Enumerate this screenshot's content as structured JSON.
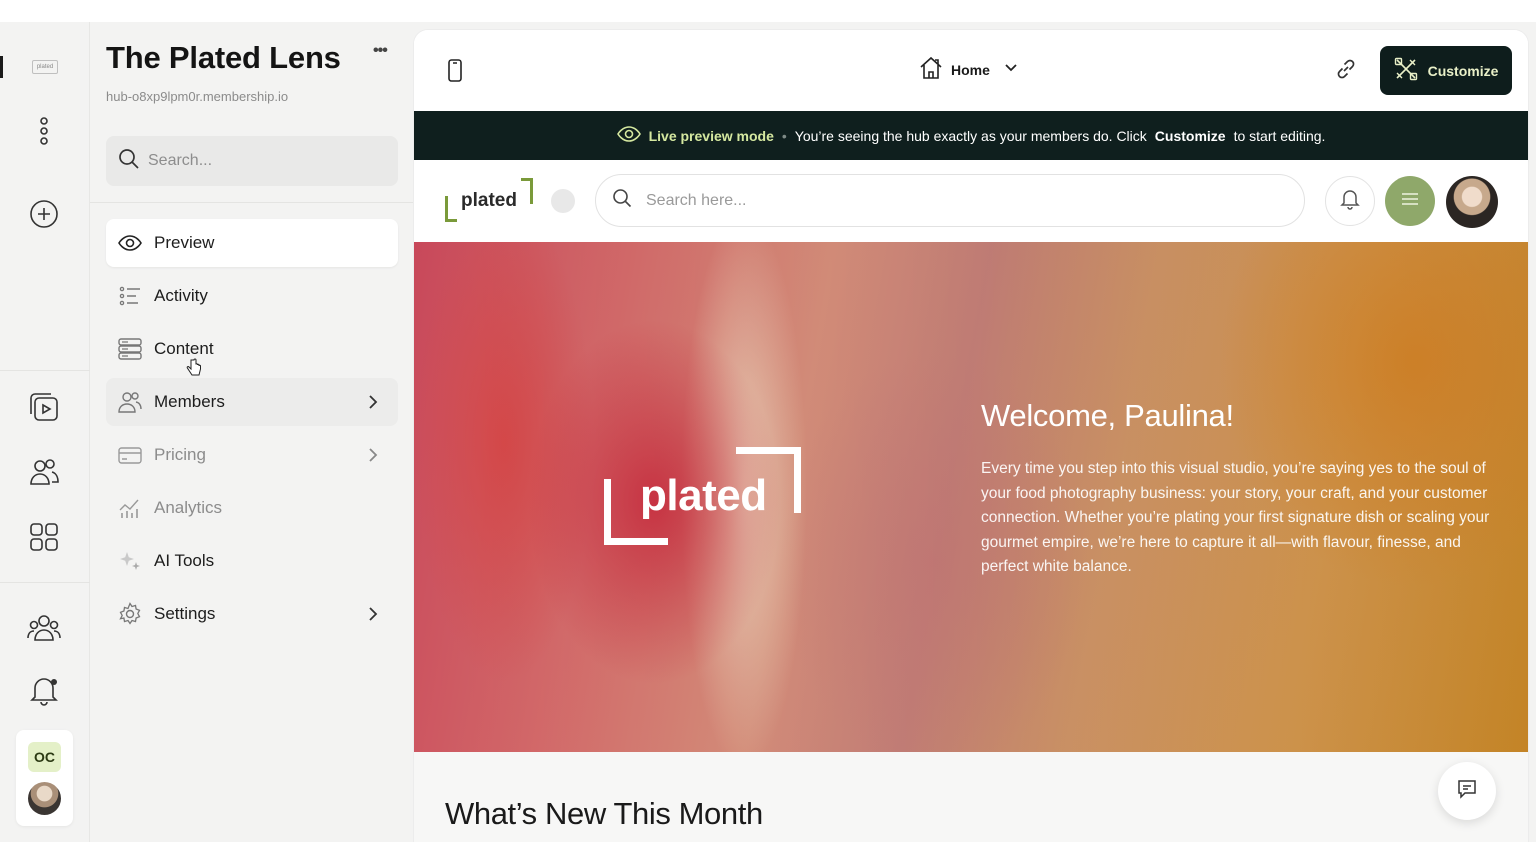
{
  "rail": {
    "logo_text": "plated"
  },
  "sidebar": {
    "hub_title": "The Plated Lens",
    "more_label": "•••",
    "hub_url": "hub-o8xp9lpm0r.membership.io",
    "search_placeholder": "Search...",
    "items": [
      {
        "label": "Preview",
        "icon": "eye-icon",
        "state": "active"
      },
      {
        "label": "Activity",
        "icon": "activity-list-icon"
      },
      {
        "label": "Content",
        "icon": "content-stack-icon"
      },
      {
        "label": "Members",
        "icon": "members-icon",
        "has_submenu": true
      },
      {
        "label": "Pricing",
        "icon": "credit-card-icon",
        "has_submenu": true,
        "muted": true
      },
      {
        "label": "Analytics",
        "icon": "analytics-chart-icon",
        "muted": true
      },
      {
        "label": "AI Tools",
        "icon": "sparkles-icon"
      },
      {
        "label": "Settings",
        "icon": "gear-icon",
        "has_submenu": true
      }
    ]
  },
  "user": {
    "initials": "OC"
  },
  "topbar": {
    "page_select": "Home",
    "customize_label": "Customize"
  },
  "banner": {
    "live_label": "Live preview mode",
    "separator": "•",
    "message_pre": "You’re seeing the hub exactly as your members do. Click",
    "message_bold": "Customize",
    "message_post": "to start editing."
  },
  "hub": {
    "logo_text": "plated",
    "search_placeholder": "Search here..."
  },
  "hero": {
    "logo_text": "plated",
    "title": "Welcome, Paulina!",
    "body": "Every time you step into this visual studio, you’re saying yes to the soul of your food photography business: your story, your craft, and your customer connection. Whether you’re plating your first signature dish or scaling your gourmet empire, we’re here to capture it all—with flavour, finesse, and perfect white balance."
  },
  "section": {
    "title": "What’s New This Month"
  },
  "colors": {
    "accent_dark": "#0f1f1e",
    "accent_lime": "#d5e8a0",
    "brand_green": "#7a9a3a"
  }
}
